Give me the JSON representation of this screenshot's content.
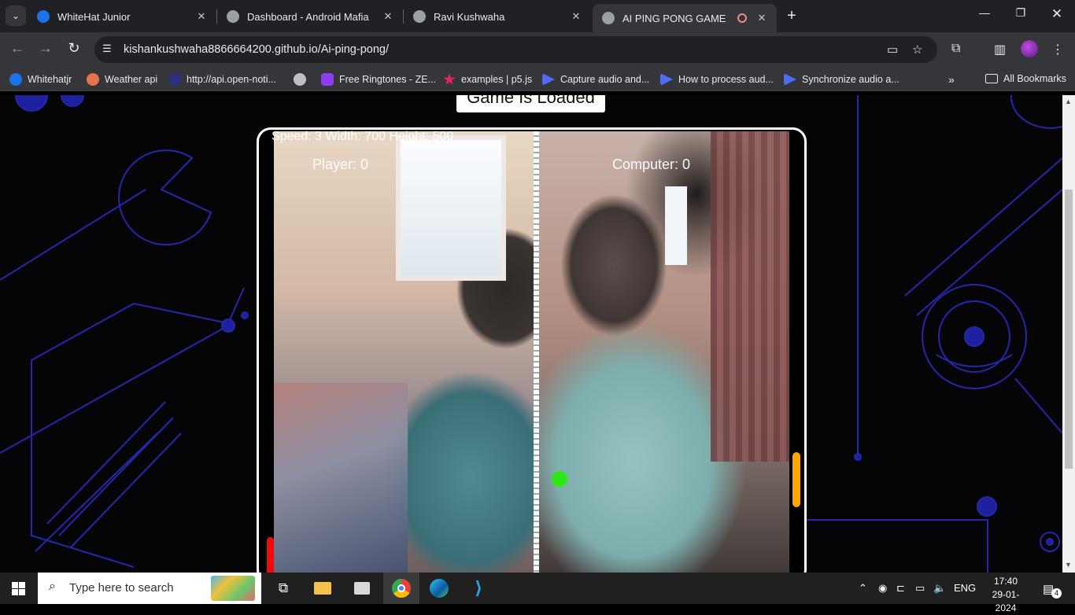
{
  "browser": {
    "tabs": [
      {
        "title": "WhiteHat Junior",
        "color": "#1a73e8"
      },
      {
        "title": "Dashboard - Android Mafia",
        "color": "#9aa0a6"
      },
      {
        "title": "Ravi Kushwaha",
        "color": "#9aa0a6"
      },
      {
        "title": "AI PING PONG GAME",
        "color": "#9aa0a6"
      }
    ],
    "url": "kishankushwaha8866664200.github.io/Ai-ping-pong/",
    "bookmarks": [
      {
        "label": "Whitehatjr"
      },
      {
        "label": "Weather api"
      },
      {
        "label": "http://api.open-noti..."
      },
      {
        "label": ""
      },
      {
        "label": "Free Ringtones - ZE..."
      },
      {
        "label": "examples | p5.js"
      },
      {
        "label": "Capture audio and..."
      },
      {
        "label": "How to process aud..."
      },
      {
        "label": "Synchronize audio a..."
      }
    ],
    "all_bookmarks": "All Bookmarks"
  },
  "page": {
    "status_button": "Game Is Loaded",
    "hud_text": "Speed: 3   Width: 700   Height: 500",
    "player_score": "Player: 0",
    "computer_score": "Computer: 0",
    "colors": {
      "left_paddle": "#ee0a0a",
      "right_paddle": "#ffa500",
      "ball": "#2ee815"
    }
  },
  "taskbar": {
    "search_placeholder": "Type here to search",
    "language": "ENG",
    "time": "17:40",
    "date": "29-01-2024",
    "notifications": "4"
  }
}
